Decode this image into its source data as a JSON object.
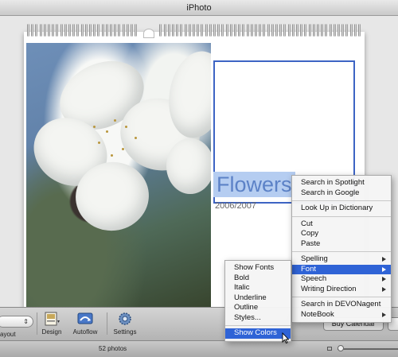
{
  "window": {
    "title": "iPhoto"
  },
  "calendar": {
    "title": "Flowers",
    "year": "2006/2007"
  },
  "context_menu": {
    "items": [
      {
        "label": "Search in Spotlight"
      },
      {
        "label": "Search in Google"
      },
      {
        "separator": true
      },
      {
        "label": "Look Up in Dictionary"
      },
      {
        "separator": true
      },
      {
        "label": "Cut"
      },
      {
        "label": "Copy"
      },
      {
        "label": "Paste"
      },
      {
        "separator": true
      },
      {
        "label": "Spelling",
        "submenu": true
      },
      {
        "label": "Font",
        "submenu": true,
        "highlighted": true
      },
      {
        "label": "Speech",
        "submenu": true
      },
      {
        "label": "Writing Direction",
        "submenu": true
      },
      {
        "separator": true
      },
      {
        "label": "Search in DEVONagent"
      },
      {
        "label": "NoteBook",
        "submenu": true
      }
    ]
  },
  "font_submenu": {
    "items": [
      {
        "label": "Show Fonts"
      },
      {
        "label": "Bold"
      },
      {
        "label": "Italic"
      },
      {
        "label": "Underline"
      },
      {
        "label": "Outline"
      },
      {
        "label": "Styles..."
      },
      {
        "separator": true
      },
      {
        "label": "Show Colors",
        "highlighted": true
      }
    ]
  },
  "toolbar": {
    "layout_label": "ayout",
    "design_label": "Design",
    "autoflow_label": "Autoflow",
    "settings_label": "Settings",
    "buy_label": "Buy Calendar"
  },
  "status": {
    "photo_count": "52 photos"
  },
  "colors": {
    "highlight": "#2f63d6",
    "title_selection": "#b5cdf1",
    "title_text": "#5c82c7",
    "textbox_border": "#3d64c4"
  },
  "icons": [
    "chevron-right-icon",
    "design-icon",
    "autoflow-icon",
    "settings-gear-icon",
    "pointer-cursor-icon",
    "zoom-slider-icon"
  ]
}
